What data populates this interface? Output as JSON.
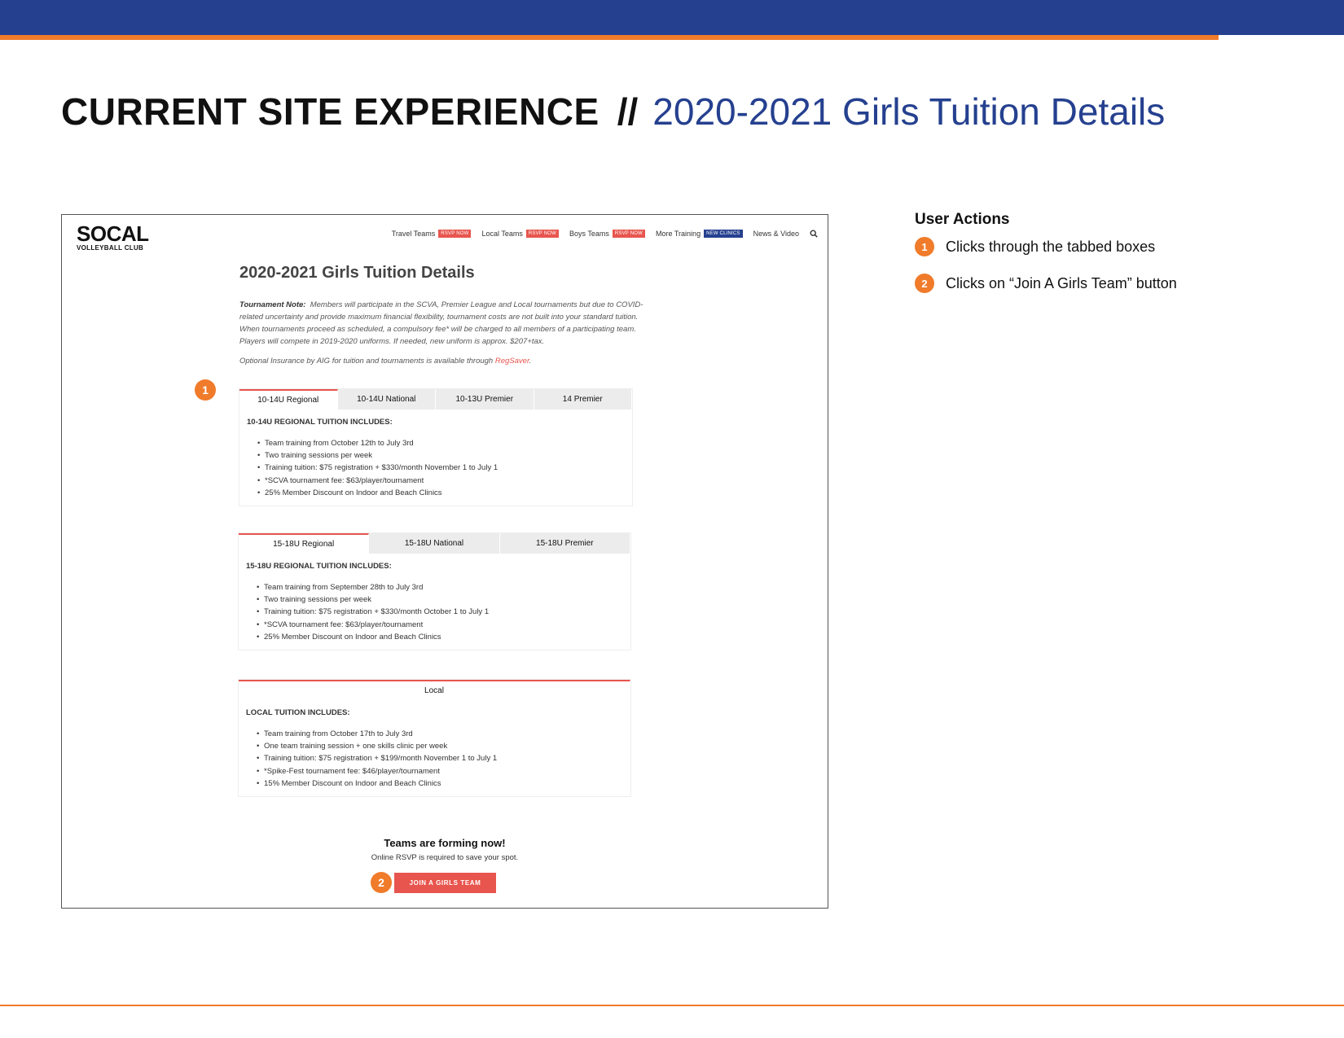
{
  "slide": {
    "title_bold": "CURRENT SITE EXPERIENCE",
    "separator": "//",
    "title_light": "2020-2021 Girls Tuition Details"
  },
  "colors": {
    "navy": "#25408f",
    "orange": "#f07b2a",
    "coral": "#e8554e"
  },
  "site": {
    "logo_main": "SOCAL",
    "logo_sub": "VOLLEYBALL CLUB",
    "nav": [
      {
        "label": "Travel Teams",
        "badge": "RSVP NOW"
      },
      {
        "label": "Local Teams",
        "badge": "RSVP NOW"
      },
      {
        "label": "Boys Teams",
        "badge": "RSVP NOW"
      },
      {
        "label": "More Training",
        "badge": "NEW CLINICS"
      },
      {
        "label": "News & Video"
      }
    ],
    "search_icon": "search-icon",
    "page_title": "2020-2021 Girls Tuition Details",
    "note_label": "Tournament Note:",
    "note_text": "Members will participate in the SCVA, Premier League and Local tournaments but due to COVID-related uncertainty and provide maximum financial flexibility, tournament costs are not built into your standard tuition. When tournaments proceed as scheduled, a compulsory fee* will be charged to all members of a participating team. Players will compete in 2019-2020 uniforms. If needed, new uniform is approx. $207+tax.",
    "insurance_text": "Optional Insurance by AIG for tuition and tournaments is available through",
    "insurance_link": "RegSaver",
    "insurance_end": ".",
    "tabbox1": {
      "tabs": [
        "10-14U Regional",
        "10-14U National",
        "10-13U Premier",
        "14 Premier"
      ],
      "heading": "10-14U REGIONAL TUITION INCLUDES:",
      "items": [
        "Team training from October 12th to July 3rd",
        "Two training sessions per week",
        "Training tuition: $75 registration + $330/month November 1 to July 1",
        "*SCVA tournament fee: $63/player/tournament",
        "25% Member Discount on Indoor and Beach Clinics"
      ]
    },
    "tabbox2": {
      "tabs": [
        "15-18U Regional",
        "15-18U National",
        "15-18U Premier"
      ],
      "heading": "15-18U REGIONAL TUITION INCLUDES:",
      "items": [
        "Team training from September 28th to July 3rd",
        "Two training sessions per week",
        "Training tuition: $75 registration + $330/month October 1 to July 1",
        "*SCVA tournament fee: $63/player/tournament",
        "25% Member Discount on Indoor and Beach Clinics"
      ]
    },
    "tabbox3": {
      "tabs": [
        "Local"
      ],
      "heading": "LOCAL TUITION INCLUDES:",
      "items": [
        "Team training from October 17th to July 3rd",
        "One team training session + one skills clinic per week",
        "Training tuition: $75 registration + $199/month November 1 to July 1",
        "*Spike-Fest tournament fee: $46/player/tournament",
        "15% Member Discount on Indoor and Beach Clinics"
      ]
    },
    "cta_heading": "Teams are forming now!",
    "cta_sub": "Online RSVP is required to save your spot.",
    "cta_button": "JOIN A GIRLS TEAM"
  },
  "markers": [
    "1",
    "2"
  ],
  "user_actions": {
    "heading": "User Actions",
    "items": [
      {
        "num": "1",
        "text": "Clicks through the tabbed boxes"
      },
      {
        "num": "2",
        "text": "Clicks on “Join A Girls Team” button"
      }
    ]
  }
}
